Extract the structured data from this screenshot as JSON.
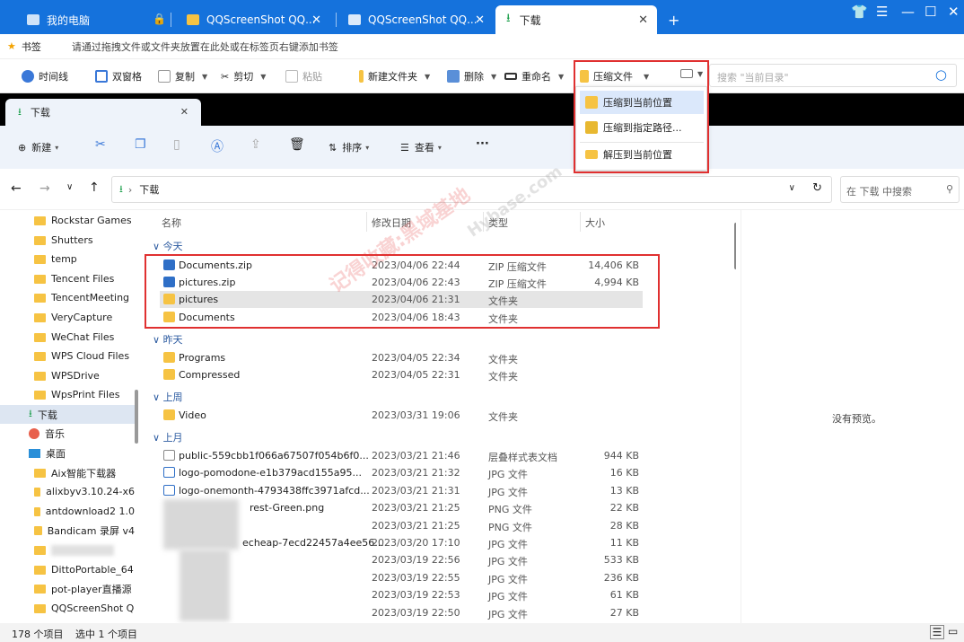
{
  "titlebar": {
    "tabs": [
      {
        "label": "我的电脑"
      },
      {
        "label": "QQScreenShot QQ..."
      },
      {
        "label": "QQScreenShot QQ..."
      },
      {
        "label": "下载"
      }
    ],
    "new_tab": "+"
  },
  "bookmarks": {
    "label": "书签",
    "hint": "请通过拖拽文件或文件夹放置在此处或在标签页右键添加书签"
  },
  "toolbar": {
    "timeline": "时间线",
    "dual": "双窗格",
    "copy": "复制",
    "cut": "剪切",
    "paste": "粘贴",
    "newfolder": "新建文件夹",
    "delete": "删除",
    "rename": "重命名",
    "compress": "压缩文件",
    "search_placeholder": "搜索 \"当前目录\""
  },
  "compress_menu": {
    "items": [
      "压缩到当前位置",
      "压缩到指定路径...",
      "解压到当前位置"
    ]
  },
  "inner_tab": {
    "label": "下载"
  },
  "cmdbar": {
    "new": "新建",
    "sort": "排序",
    "view": "查看",
    "more": "···"
  },
  "address": {
    "path": "下载",
    "search_placeholder": "在 下载 中搜索"
  },
  "sidebar": [
    "Rockstar Games",
    "Shutters",
    "temp",
    "Tencent Files",
    "TencentMeeting",
    "VeryCapture",
    "WeChat Files",
    "WPS Cloud Files",
    "WPSDrive",
    "WpsPrint Files",
    "下载",
    "音乐",
    "桌面",
    "Aix智能下载器",
    "alixbyv3.10.24-x6",
    "antdownload2 1.0",
    "Bandicam 录屏 v4",
    "",
    "DittoPortable_64",
    "pot-player直播源",
    "QQScreenShot Q"
  ],
  "columns": {
    "name": "名称",
    "date": "修改日期",
    "type": "类型",
    "size": "大小"
  },
  "groups": {
    "today": "今天",
    "yesterday": "昨天",
    "lastweek": "上周",
    "lastmonth": "上月"
  },
  "rows": [
    {
      "name": "Documents.zip",
      "date": "2023/04/06 22:44",
      "type": "ZIP 压缩文件",
      "size": "14,406 KB"
    },
    {
      "name": "pictures.zip",
      "date": "2023/04/06 22:43",
      "type": "ZIP 压缩文件",
      "size": "4,994 KB"
    },
    {
      "name": "pictures",
      "date": "2023/04/06 21:31",
      "type": "文件夹",
      "size": ""
    },
    {
      "name": "Documents",
      "date": "2023/04/06 18:43",
      "type": "文件夹",
      "size": ""
    },
    {
      "name": "Programs",
      "date": "2023/04/05 22:34",
      "type": "文件夹",
      "size": ""
    },
    {
      "name": "Compressed",
      "date": "2023/04/05 22:31",
      "type": "文件夹",
      "size": ""
    },
    {
      "name": "Video",
      "date": "2023/03/31 19:06",
      "type": "文件夹",
      "size": ""
    },
    {
      "name": "public-559cbb1f066a67507f054b6f0...",
      "date": "2023/03/21 21:46",
      "type": "层叠样式表文档",
      "size": "944 KB"
    },
    {
      "name": "logo-pomodone-e1b379acd155a95...",
      "date": "2023/03/21 21:32",
      "type": "JPG 文件",
      "size": "16 KB"
    },
    {
      "name": "logo-onemonth-4793438ffc3971afcd...",
      "date": "2023/03/21 21:31",
      "type": "JPG 文件",
      "size": "13 KB"
    },
    {
      "name": "rest-Green.png",
      "date": "2023/03/21 21:25",
      "type": "PNG 文件",
      "size": "22 KB"
    },
    {
      "name": "",
      "date": "2023/03/21 21:25",
      "type": "PNG 文件",
      "size": "28 KB"
    },
    {
      "name": "echeap-7ecd22457a4ee56...",
      "date": "2023/03/20 17:10",
      "type": "JPG 文件",
      "size": "11 KB"
    },
    {
      "name": "",
      "date": "2023/03/19 22:56",
      "type": "JPG 文件",
      "size": "533 KB"
    },
    {
      "name": "",
      "date": "2023/03/19 22:55",
      "type": "JPG 文件",
      "size": "236 KB"
    },
    {
      "name": "",
      "date": "2023/03/19 22:53",
      "type": "JPG 文件",
      "size": "61 KB"
    },
    {
      "name": "",
      "date": "2023/03/19 22:50",
      "type": "JPG 文件",
      "size": "27 KB"
    }
  ],
  "preview": {
    "text": "没有预览。"
  },
  "status": {
    "count": "178 个项目",
    "selected": "选中 1 个项目"
  },
  "watermark": {
    "text": "记得收藏:黑域基地",
    "text2": "Hybase.com"
  },
  "colors": {
    "accent": "#1572dc",
    "highlight_box": "#e03030"
  }
}
